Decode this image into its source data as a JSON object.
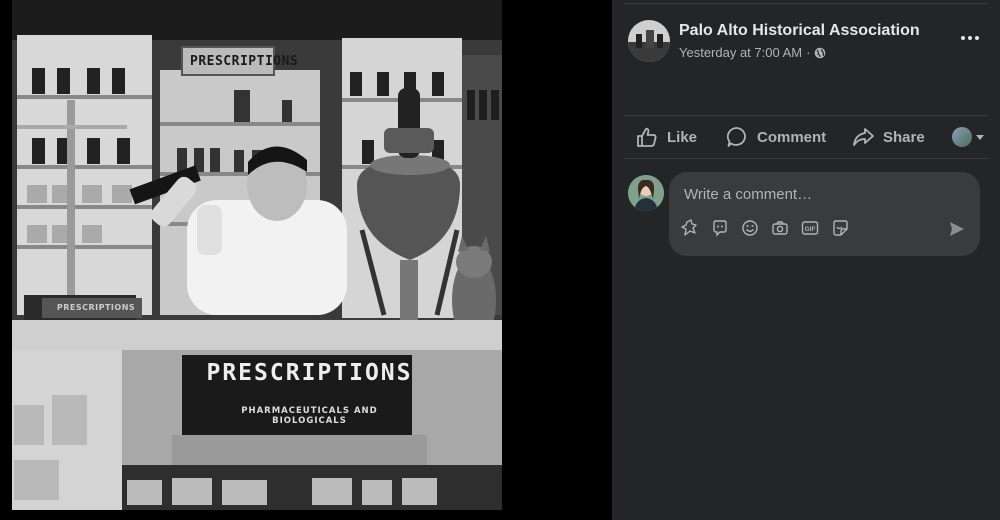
{
  "photo": {
    "alt": "Pharmacist with cat at prescription counter",
    "sign_top": "PRESCRIPTIONS",
    "counter_sign": "PRESCRIPTIONS",
    "counter_subtitle": "PHARMACEUTICALS AND BIOLOGICALS",
    "scale_base_sign": "PRESCRIPTIONS"
  },
  "post": {
    "page_name": "Palo Alto Historical Association",
    "timestamp": "Yesterday at 7:00 AM",
    "separator": "·",
    "audience_icon": "globe-icon",
    "more_icon": "more-horizontal-icon"
  },
  "actions": {
    "like_label": "Like",
    "comment_label": "Comment",
    "share_label": "Share",
    "like_icon": "thumbs-up-icon",
    "comment_icon": "speech-bubble-icon",
    "share_icon": "share-arrow-icon"
  },
  "composer": {
    "placeholder": "Write a comment…",
    "tools": [
      "avatar-sticker-icon",
      "gif-picker-icon",
      "emoji-icon",
      "camera-icon",
      "gif-icon",
      "sticker-icon"
    ],
    "gif_label": "GIF",
    "send_icon": "send-icon"
  },
  "colors": {
    "panel_bg": "#242526",
    "box_bg": "#3a3b3c",
    "text_primary": "#e4e6eb",
    "text_secondary": "#b0b3b8"
  }
}
